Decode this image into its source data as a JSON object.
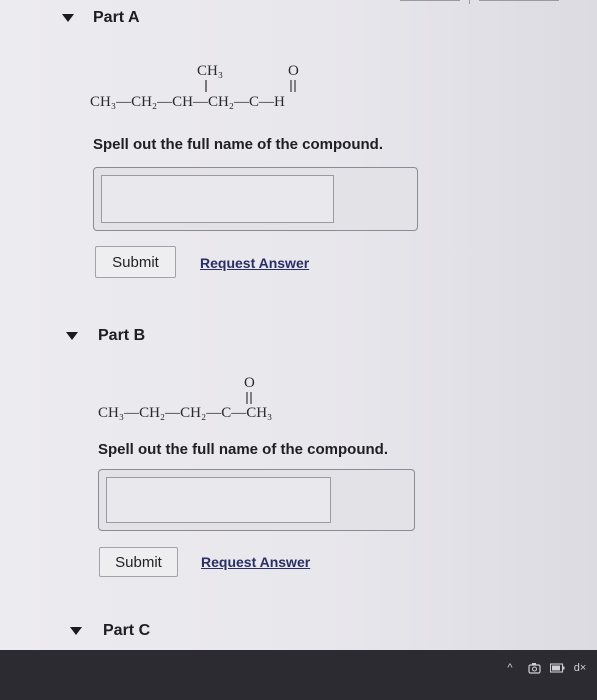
{
  "partA": {
    "title": "Part A",
    "formula": {
      "branch": "CH₃",
      "carbonyl_O": "O",
      "main": "CH₃—CH₂—CH—CH₂—C—H"
    },
    "prompt": "Spell out the full name of the compound.",
    "answer_value": "",
    "submit_label": "Submit",
    "request_label": "Request Answer"
  },
  "partB": {
    "title": "Part B",
    "formula": {
      "carbonyl_O": "O",
      "main": "CH₃—CH₂—CH₂—C—CH₃"
    },
    "prompt": "Spell out the full name of the compound.",
    "answer_value": "",
    "submit_label": "Submit",
    "request_label": "Request Answer"
  },
  "partC": {
    "title": "Part C"
  },
  "taskbar": {
    "tray_icons": [
      "chevron-up-icon",
      "camera-icon",
      "battery-icon",
      "speaker-muted-icon"
    ],
    "tray_chevron": "^",
    "tray_mute": "d×"
  },
  "colors": {
    "page_bg": "#ecebef",
    "taskbar_bg": "#2c2b31",
    "link": "#2b2d66"
  }
}
